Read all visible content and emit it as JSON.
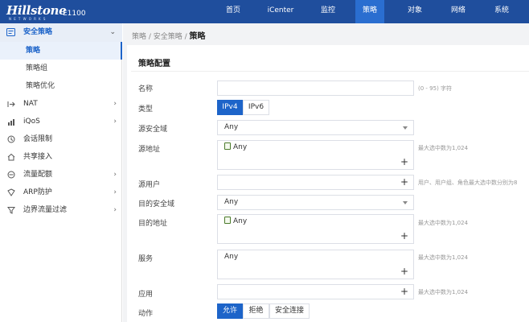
{
  "header": {
    "logo": "Hillstone",
    "logo_sub": "NETWORKS",
    "model": "E1100",
    "nav": [
      "首页",
      "iCenter",
      "监控",
      "策略",
      "对象",
      "网络",
      "系统"
    ],
    "active_nav": "策略"
  },
  "sidebar": {
    "section": "安全策略",
    "sub_items": [
      "策略",
      "策略组",
      "策略优化"
    ],
    "active_sub": "策略",
    "items": [
      {
        "label": "NAT",
        "icon": "nat-icon",
        "has_arrow": true
      },
      {
        "label": "iQoS",
        "icon": "bar-chart-icon",
        "has_arrow": true
      },
      {
        "label": "会话限制",
        "icon": "session-limit-icon",
        "has_arrow": false
      },
      {
        "label": "共享接入",
        "icon": "home-icon",
        "has_arrow": false
      },
      {
        "label": "流量配额",
        "icon": "quota-icon",
        "has_arrow": true
      },
      {
        "label": "ARP防护",
        "icon": "shield-icon",
        "has_arrow": true
      },
      {
        "label": "边界流量过滤",
        "icon": "filter-icon",
        "has_arrow": true
      }
    ]
  },
  "breadcrumb": {
    "path": "策略 / 安全策略 / ",
    "current": "策略"
  },
  "form": {
    "title": "策略配置",
    "name": {
      "label": "名称",
      "value": "",
      "hint": "(0 - 95) 字符"
    },
    "type": {
      "label": "类型",
      "options": [
        "IPv4",
        "IPv6"
      ],
      "selected": "IPv4"
    },
    "src_zone": {
      "label": "源安全域",
      "value": "Any"
    },
    "src_addr": {
      "label": "源地址",
      "value": "Any",
      "hint": "最大选中数为1,024"
    },
    "src_user": {
      "label": "源用户",
      "value": "",
      "hint": "用户、用户组、角色最大选中数分别为8"
    },
    "dst_zone": {
      "label": "目的安全域",
      "value": "Any"
    },
    "dst_addr": {
      "label": "目的地址",
      "value": "Any",
      "hint": "最大选中数为1,024"
    },
    "service": {
      "label": "服务",
      "value": "Any",
      "hint": "最大选中数为1,024"
    },
    "app": {
      "label": "应用",
      "value": "",
      "hint": "最大选中数为1,024"
    },
    "action": {
      "label": "动作",
      "options": [
        "允许",
        "拒绝",
        "安全连接"
      ],
      "selected": "允许"
    }
  },
  "colors": {
    "header_bg": "#1f4e9d",
    "accent": "#1d64c9"
  }
}
